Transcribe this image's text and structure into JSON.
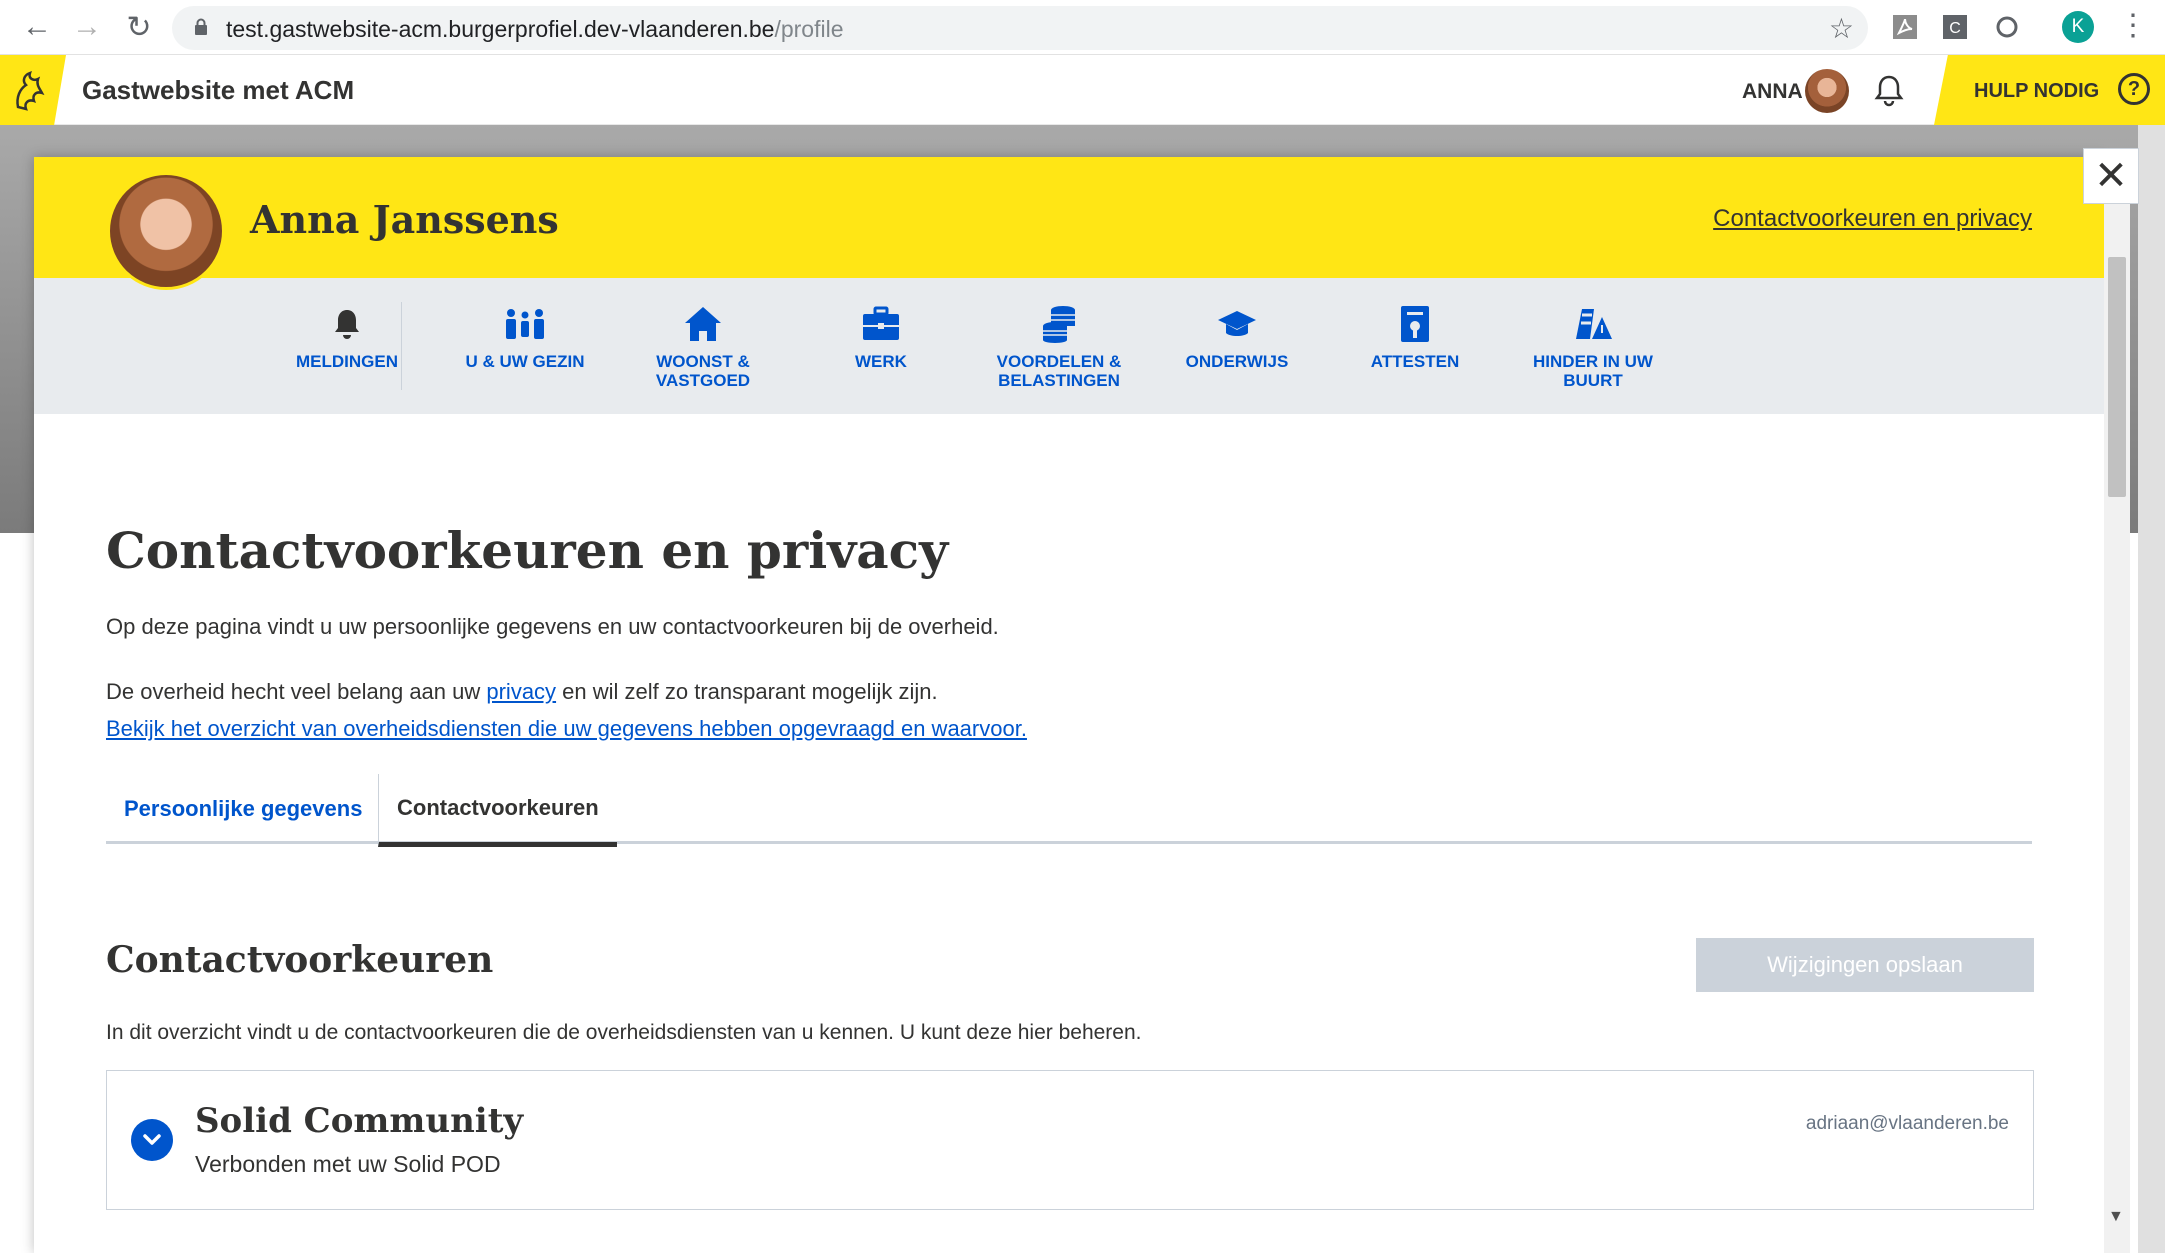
{
  "browser": {
    "url_host": "test.gastwebsite-acm.burgerprofiel.dev-vlaanderen.be",
    "url_path": "/profile",
    "profile_initial": "K"
  },
  "header": {
    "site_title": "Gastwebsite met ACM",
    "user_name": "ANNA",
    "help_label": "HULP NODIG",
    "help_symbol": "?"
  },
  "profile": {
    "name": "Anna Janssens",
    "contact_link": "Contactvoorkeuren en privacy",
    "close_symbol": "✕"
  },
  "nav": {
    "items": [
      {
        "label": "MELDINGEN",
        "icon": "bell-icon"
      },
      {
        "label": "U & UW GEZIN",
        "icon": "family-icon"
      },
      {
        "label": "WOONST & VASTGOED",
        "icon": "house-icon"
      },
      {
        "label": "WERK",
        "icon": "briefcase-icon"
      },
      {
        "label": "VOORDELEN & BELASTINGEN",
        "icon": "coins-icon"
      },
      {
        "label": "ONDERWIJS",
        "icon": "graduation-cap-icon"
      },
      {
        "label": "ATTESTEN",
        "icon": "document-icon"
      },
      {
        "label": "HINDER IN UW BUURT",
        "icon": "roadwork-icon"
      }
    ]
  },
  "main": {
    "title": "Contactvoorkeuren en privacy",
    "intro": "Op deze pagina vindt u uw persoonlijke gegevens en uw contactvoorkeuren bij de overheid.",
    "privacy_before": "De overheid hecht veel belang aan uw ",
    "privacy_link": "privacy",
    "privacy_after": " en wil zelf zo transparant mogelijk zijn.",
    "overview_link": "Bekijk het overzicht van overheidsdiensten die uw gegevens hebben opgevraagd en waarvoor.",
    "tabs": [
      {
        "label": "Persoonlijke gegevens"
      },
      {
        "label": "Contactvoorkeuren"
      }
    ],
    "section_title": "Contactvoorkeuren",
    "save_button": "Wijzigingen opslaan",
    "section_desc": "In dit overzicht vindt u de contactvoorkeuren die de overheidsdiensten van u kennen. U kunt deze hier beheren.",
    "card": {
      "title": "Solid Community",
      "subtitle": "Verbonden met uw Solid POD",
      "email": "adriaan@vlaanderen.be"
    }
  },
  "colors": {
    "accent_yellow": "#ffe615",
    "link_blue": "#0055cc",
    "nav_bg": "#e8ebee"
  }
}
